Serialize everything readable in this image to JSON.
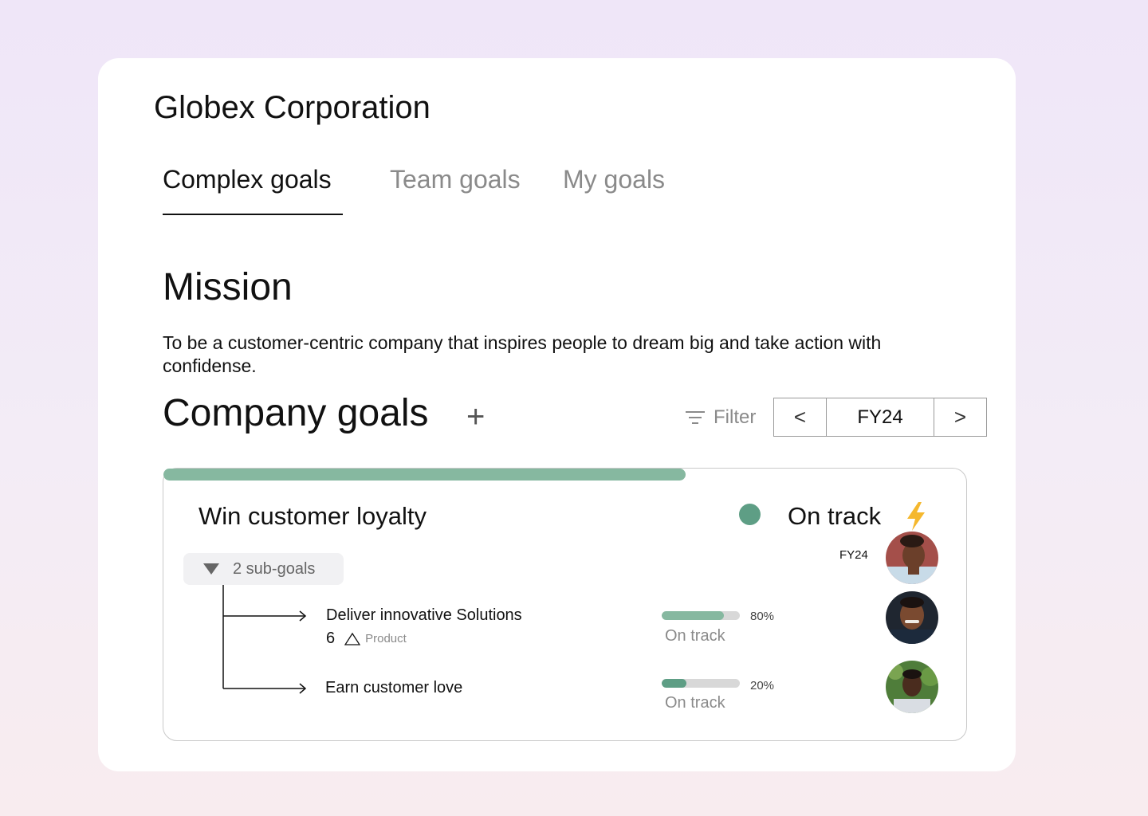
{
  "company": {
    "name": "Globex Corporation"
  },
  "tabs": [
    {
      "label": "Complex goals",
      "active": true
    },
    {
      "label": "Team goals",
      "active": false
    },
    {
      "label": "My goals",
      "active": false
    }
  ],
  "mission": {
    "heading": "Mission",
    "text": "To be a customer-centric company that inspires people to dream big and take action with confidense."
  },
  "goals_section": {
    "heading": "Company goals",
    "add_label": "+",
    "filter_label": "Filter",
    "filter_icon": "filter-icon",
    "period": {
      "prev_label": "<",
      "value": "FY24",
      "next_label": ">"
    }
  },
  "goal": {
    "title": "Win customer loyalty",
    "progress": 0.65,
    "status": "On track",
    "status_color": "#5e9e85",
    "status_icon": "lightning-icon",
    "period": "FY24",
    "owner_avatar": "avatar-woman",
    "subgoals_toggle": {
      "label": "2 sub-goals",
      "icon": "caret-down-icon"
    },
    "subgoals": [
      {
        "title": "Deliver innovative Solutions",
        "count": "6",
        "team": "Product",
        "team_icon": "triangle-icon",
        "progress": 0.8,
        "progress_label": "80%",
        "status": "On track",
        "avatar": "avatar-man-smiling"
      },
      {
        "title": "Earn customer love",
        "progress": 0.2,
        "progress_label": "20%",
        "status": "On track",
        "avatar": "avatar-man-outdoors"
      }
    ]
  },
  "colors": {
    "progress_light": "#86b8a0",
    "progress_dark": "#5e9e85",
    "track": "#d8d8d8",
    "accent_bolt": "#f5b82e"
  }
}
